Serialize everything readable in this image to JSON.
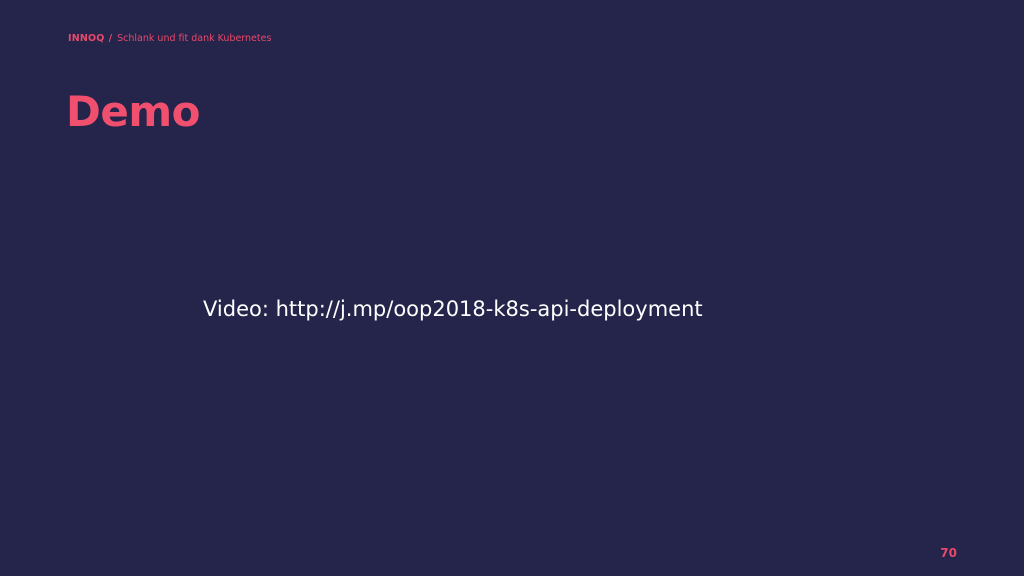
{
  "header": {
    "brand": "INNOQ",
    "separator": "/",
    "talk_title": "Schlank und fit dank Kubernetes"
  },
  "slide": {
    "title": "Demo",
    "video_label": "Video:",
    "video_url": "http://j.mp/oop2018-k8s-api-deployment",
    "page_number": "70"
  },
  "colors": {
    "background": "#25244b",
    "accent": "#f0506e",
    "text": "#ffffff"
  }
}
